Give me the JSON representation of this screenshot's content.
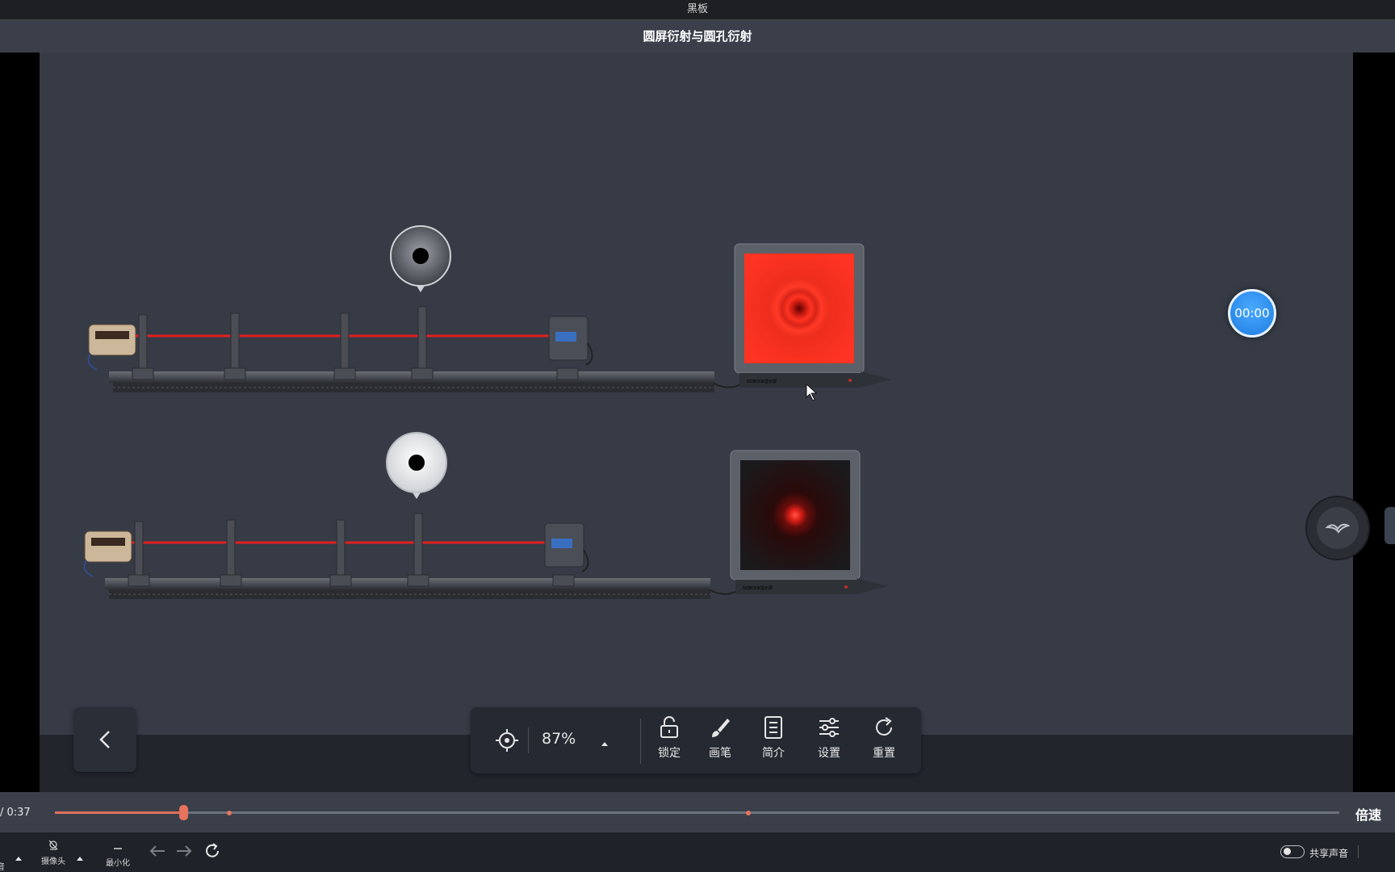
{
  "window": {
    "title": "黑板"
  },
  "lesson": {
    "title": "圆屏衍射与圆孔衍射"
  },
  "timer": {
    "value": "00:00"
  },
  "toolbar": {
    "zoom": "87%",
    "lock": "锁定",
    "pen": "画笔",
    "intro": "简介",
    "settings": "设置",
    "reset": "重置"
  },
  "player": {
    "time": "/  0:37",
    "speed": "倍速",
    "progress_fraction": 0.1
  },
  "bottombar": {
    "camera": "摄像头",
    "minimize": "最小化",
    "share_audio": "共享声音",
    "left_fragment": "音"
  },
  "experiment": {
    "screen_label_1": "NOBOOK显示屏",
    "screen_label_2": "NOBOOK显示屏"
  },
  "colors": {
    "accent": "#e8735d",
    "timer": "#1e7de0",
    "laser": "#e02020",
    "screen_red": "#ff3322"
  }
}
